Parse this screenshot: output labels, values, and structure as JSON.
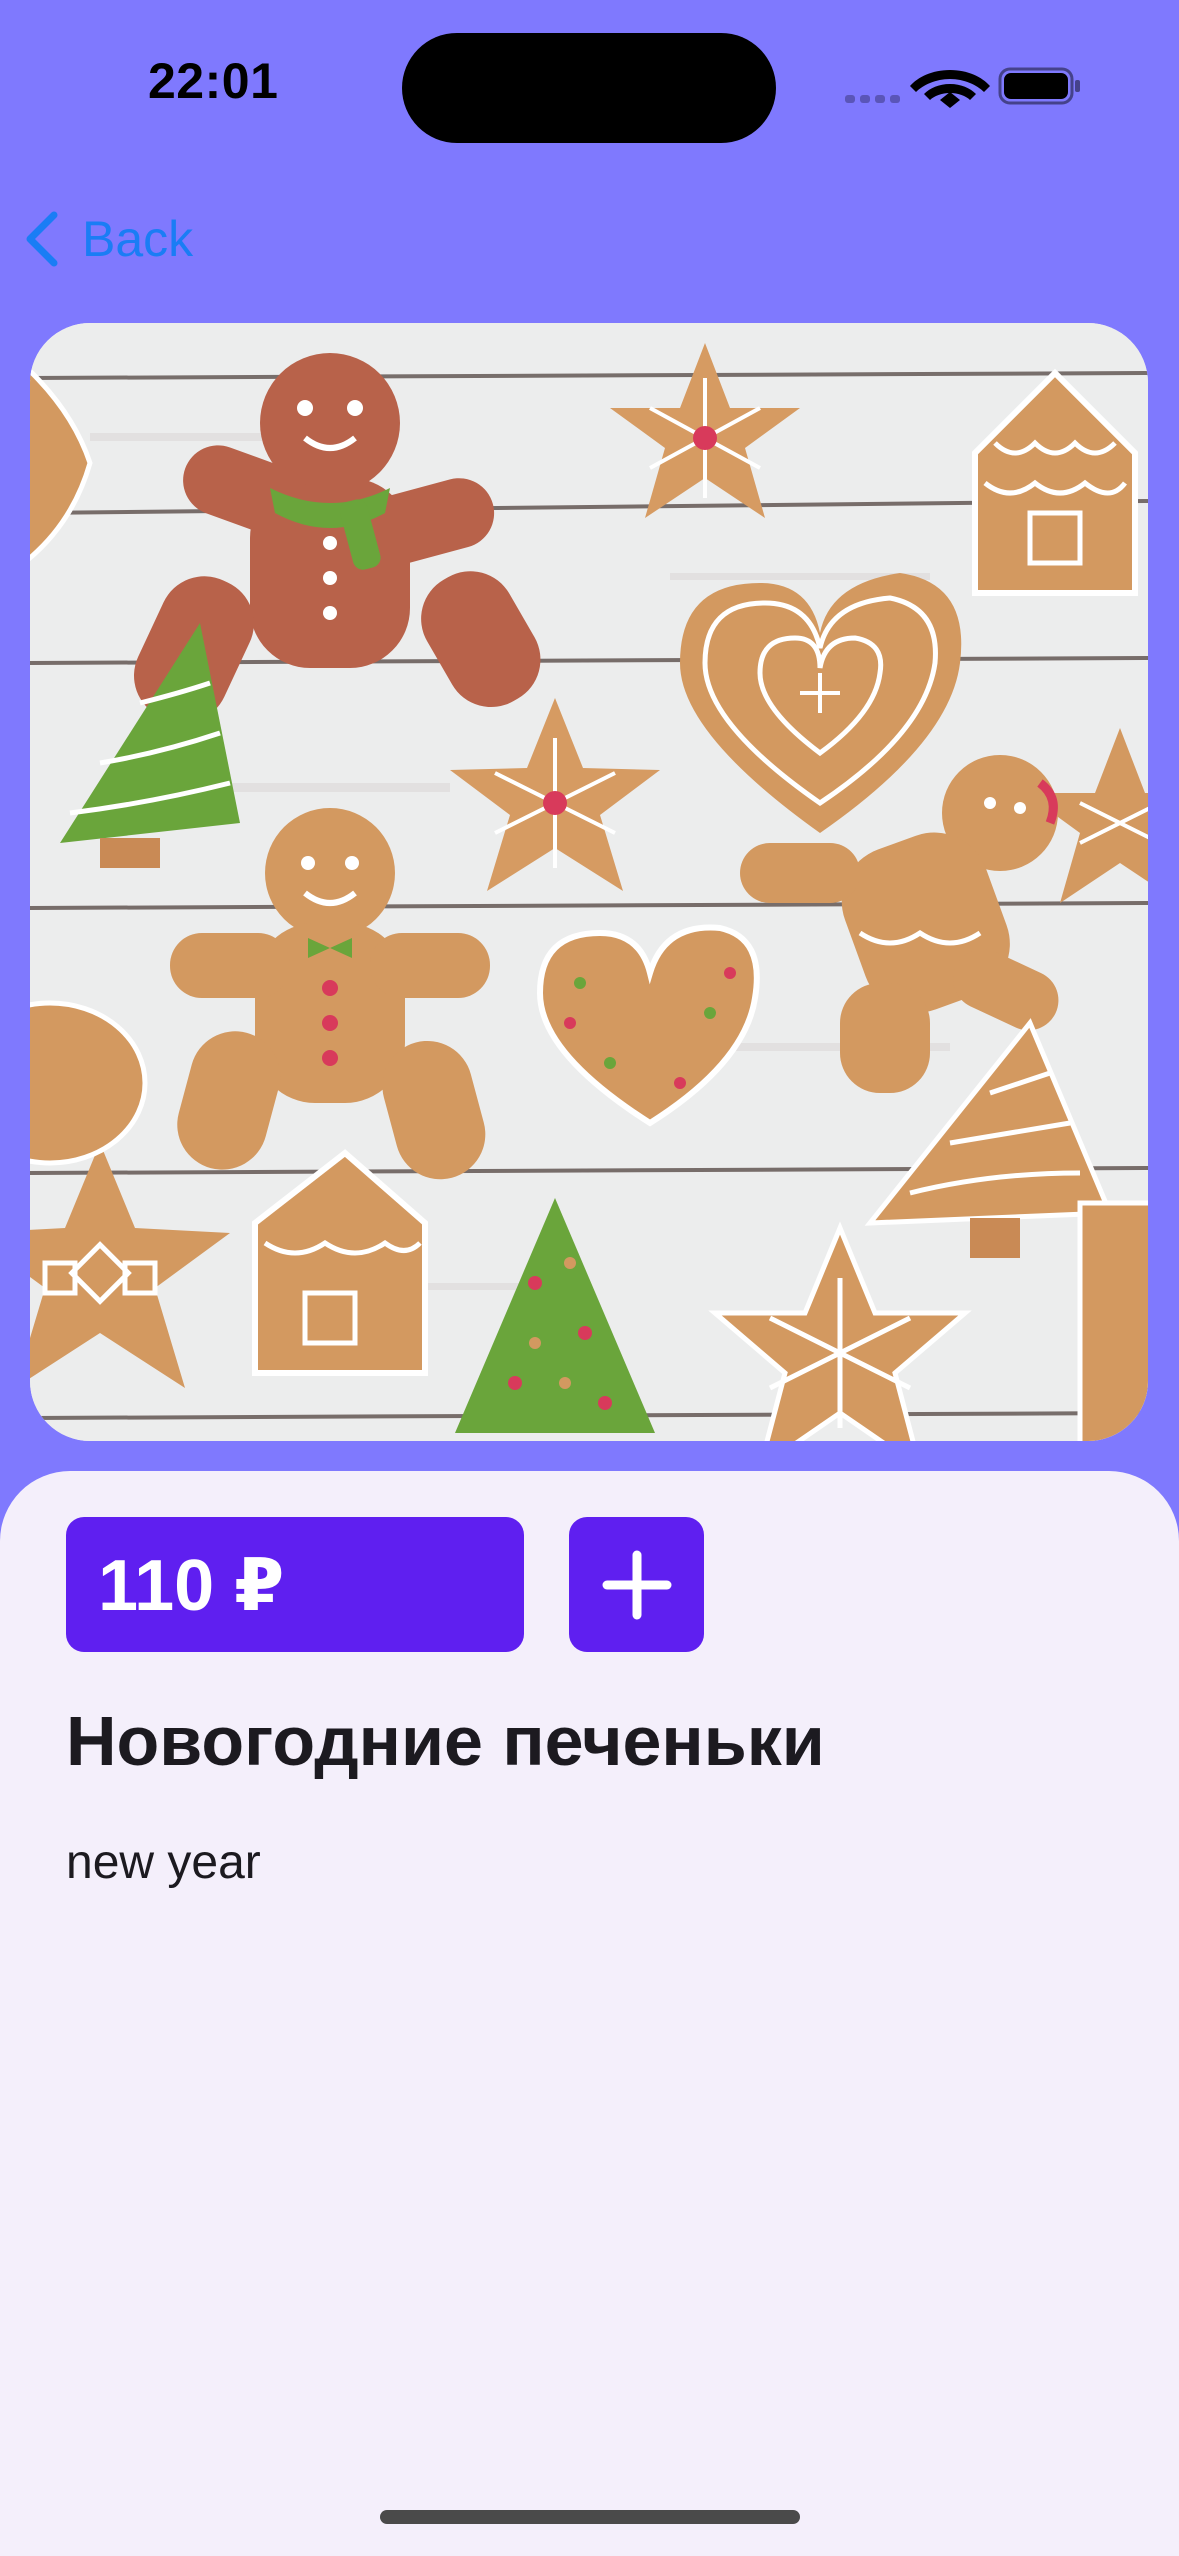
{
  "status_bar": {
    "time": "22:01"
  },
  "nav": {
    "back_label": "Back"
  },
  "hero": {
    "icon": "gingerbread-cookies-photo"
  },
  "product": {
    "price": "110 ₽",
    "title": "Новогодние печеньки",
    "description": "new year"
  },
  "colors": {
    "background": "#7f79fe",
    "accent": "#5f1ff0",
    "sheet": "#f4effb",
    "link": "#1a7df5"
  }
}
